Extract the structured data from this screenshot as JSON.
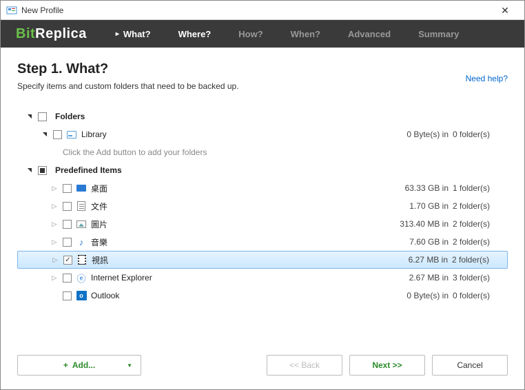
{
  "window": {
    "title": "New Profile"
  },
  "brand": {
    "part1": "Bit",
    "part2": "Replica"
  },
  "tabs": [
    {
      "label": "What?",
      "state": "active"
    },
    {
      "label": "Where?",
      "state": "done"
    },
    {
      "label": "How?",
      "state": ""
    },
    {
      "label": "When?",
      "state": ""
    },
    {
      "label": "Advanced",
      "state": ""
    },
    {
      "label": "Summary",
      "state": ""
    }
  ],
  "step": {
    "title": "Step 1. What?",
    "subtitle": "Specify items and custom folders that need to be backed up.",
    "help": "Need help?"
  },
  "sections": {
    "folders": {
      "label": "Folders",
      "library": {
        "label": "Library",
        "size": "0 Byte(s) in",
        "folders": "0 folder(s)"
      },
      "hint": "Click the Add button to add your folders"
    },
    "predefined": {
      "label": "Predefined Items",
      "items": [
        {
          "label": "桌面",
          "size": "63.33 GB in",
          "folders": "1 folder(s)",
          "icon": "desktop"
        },
        {
          "label": "文件",
          "size": "1.70 GB in",
          "folders": "2 folder(s)",
          "icon": "doc"
        },
        {
          "label": "圖片",
          "size": "313.40 MB in",
          "folders": "2 folder(s)",
          "icon": "pic"
        },
        {
          "label": "音樂",
          "size": "7.60 GB in",
          "folders": "2 folder(s)",
          "icon": "music"
        },
        {
          "label": "視訊",
          "size": "6.27 MB in",
          "folders": "2 folder(s)",
          "icon": "video",
          "selected": true,
          "checked": true
        },
        {
          "label": "Internet Explorer",
          "size": "2.67 MB in",
          "folders": "3 folder(s)",
          "icon": "ie"
        },
        {
          "label": "Outlook",
          "size": "0 Byte(s) in",
          "folders": "0 folder(s)",
          "icon": "outlook",
          "noexpand": true
        }
      ]
    }
  },
  "footer": {
    "add": "Add...",
    "back": "<< Back",
    "next": "Next >>",
    "cancel": "Cancel"
  }
}
